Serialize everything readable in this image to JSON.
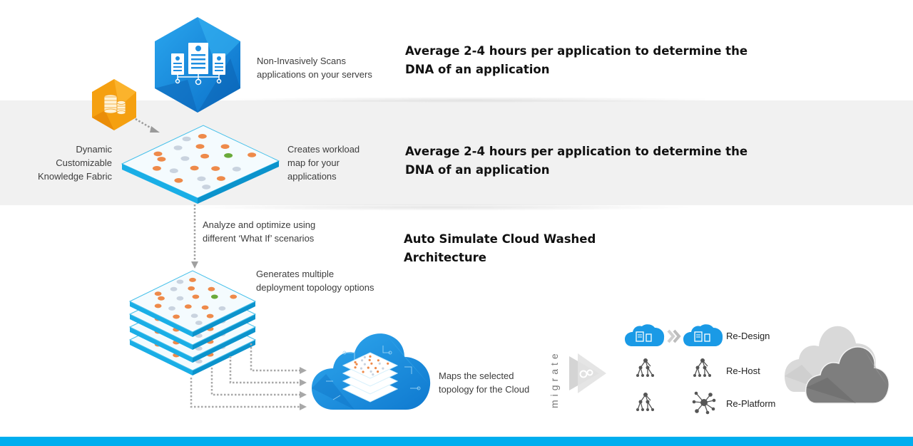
{
  "steps": {
    "scan": {
      "caption": [
        "Non-Invasively Scans",
        "applications on your servers"
      ],
      "headline": [
        "Average 2-4 hours per application to determine the",
        "DNA of an application"
      ],
      "icon": "server-scan-hexagon-icon"
    },
    "knowledge_fabric": {
      "caption": [
        "Dynamic",
        "Customizable",
        "Knowledge Fabric"
      ],
      "icon": "database-coins-hexagon-icon"
    },
    "workload_map": {
      "caption": [
        "Creates workload",
        "map for your",
        "applications"
      ],
      "headline": [
        "Average 2-4 hours per application to determine the",
        "DNA of an application"
      ],
      "icon": "workload-map-layer-icon"
    },
    "analyze": {
      "caption": [
        "Analyze and optimize using",
        "different ‘What If’ scenarios"
      ],
      "headline": [
        "Auto Simulate Cloud Washed",
        "Architecture"
      ]
    },
    "topology_options": {
      "caption": [
        "Generates multiple",
        "deployment topology options"
      ],
      "icon": "stacked-topology-layers-icon"
    },
    "cloud_map": {
      "caption": [
        "Maps the selected",
        "topology for the Cloud"
      ],
      "icon": "cloud-topology-icon"
    },
    "migrate": {
      "label": "migrate",
      "icon": "migrate-arrow-gears-icon"
    }
  },
  "migration_options": [
    {
      "label": "Re-Design",
      "from_icon": "cloud-documents-icon",
      "to_icon": "cloud-documents-icon"
    },
    {
      "label": "Re-Host",
      "from_icon": "hierarchy-tree-icon",
      "to_icon": "hierarchy-tree-icon"
    },
    {
      "label": "Re-Platform",
      "from_icon": "hierarchy-tree-icon",
      "to_icon": "hub-network-icon"
    }
  ],
  "colors": {
    "accent_blue": "#00aeef",
    "hex_blue": "#1a8fe0",
    "hex_orange": "#f5a010",
    "band_gray": "#f1f1f1",
    "node_orange": "#ee8a4a",
    "node_gray": "#c9d3df",
    "node_green": "#6aaa3a"
  }
}
